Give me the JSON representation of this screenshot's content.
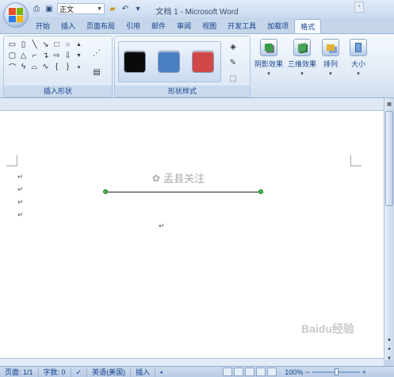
{
  "window": {
    "title": "文档 1 - Microsoft Word"
  },
  "quick_access": {
    "style_value": "正文"
  },
  "tabs": [
    {
      "label": "开始"
    },
    {
      "label": "插入"
    },
    {
      "label": "页面布局"
    },
    {
      "label": "引用"
    },
    {
      "label": "邮件"
    },
    {
      "label": "审阅"
    },
    {
      "label": "视图"
    },
    {
      "label": "开发工具"
    },
    {
      "label": "加载项"
    },
    {
      "label": "格式",
      "active": true
    }
  ],
  "ribbon": {
    "insert_shapes_label": "插入形状",
    "shape_styles_label": "形状样式",
    "swatches": [
      {
        "color": "#0a0a0a"
      },
      {
        "color": "#4a7fc1"
      },
      {
        "color": "#d04848"
      }
    ],
    "shadow_effects_label": "阴影效果",
    "three_d_effects_label": "三维效果",
    "arrange_label": "排列",
    "size_label": "大小"
  },
  "document": {
    "watermark_text": "孟县关注",
    "paragraph_mark": "↵",
    "line_color": "#222222",
    "handle_color": "#3fbd3f"
  },
  "statusbar": {
    "page": "页面: 1/1",
    "words": "字数: 0",
    "language": "英语(美国)",
    "mode": "插入",
    "zoom": "100%",
    "zoom_minus": "−",
    "zoom_plus": "+"
  },
  "overlay": {
    "baidu_text": "Baidu经验"
  }
}
